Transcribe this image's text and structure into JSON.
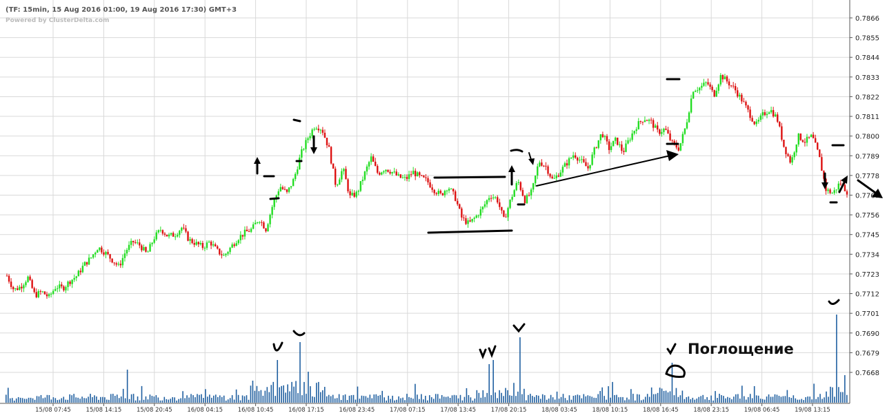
{
  "header": {
    "title": "(TF: 15min, 15 Aug 2016 01:00, 19 Aug 2016 17:30) GMT+3",
    "credit": "Powered by ClusterDelta.com"
  },
  "annotation_label": "Поглощение",
  "colors": {
    "up_candle": "#22dd22",
    "down_candle": "#dd1111",
    "volume": "#1f5fa0",
    "grid": "#d9d9d9",
    "drawing": "#000000"
  },
  "chart_data": {
    "type": "candlestick",
    "symbol_timeframe": "15min",
    "y_ticks": [
      0.7866,
      0.7855,
      0.7844,
      0.7833,
      0.7822,
      0.7811,
      0.78,
      0.7789,
      0.7778,
      0.7767,
      0.7756,
      0.7745,
      0.7734,
      0.7723,
      0.7712,
      0.7701,
      0.769,
      0.7679,
      0.7668
    ],
    "y_tick_labels": [
      "0.7866",
      "0.7855",
      "0.7844",
      "0.7833",
      "0.7822",
      "0.7811",
      "0.7800",
      "0.7789",
      "0.7778",
      "0.7767",
      "0.7756",
      "0.7745",
      "0.7734",
      "0.7723",
      "0.7712",
      "0.7701",
      "0.7690",
      "0.7679",
      "0.7668"
    ],
    "ylim": [
      0.7661,
      0.7871
    ],
    "x_tick_labels": [
      "15/08 07:45",
      "15/08 14:15",
      "15/08 20:45",
      "16/08 04:15",
      "16/08 10:45",
      "16/08 17:15",
      "16/08 23:45",
      "17/08 07:15",
      "17/08 13:45",
      "17/08 20:15",
      "18/08 03:45",
      "18/08 10:15",
      "18/08 16:45",
      "18/08 23:15",
      "19/08 06:45",
      "19/08 13:15"
    ],
    "price_path": [
      [
        0.7722,
        0.7714,
        0.7716,
        0.7721,
        0.7711,
        0.7713,
        0.771,
        0.7716,
        0.7715,
        0.7719,
        0.7722,
        0.7728,
        0.7732,
        0.7738,
        0.7735,
        0.7731,
        0.7727,
        0.7736,
        0.7741,
        0.7739,
        0.7734,
        0.7743,
        0.7748,
        0.7744,
        0.7745,
        0.7749,
        0.7742,
        0.774,
        0.7738,
        0.7741,
        0.7736,
        0.7733,
        0.7738,
        0.7743,
        0.7746,
        0.7748,
        0.7754,
        0.7748,
        0.7762,
        0.7772,
        0.7768,
        0.7776,
        0.779,
        0.7799,
        0.7806,
        0.7804,
        0.7793,
        0.7772,
        0.7782,
        0.7766,
        0.7768,
        0.7778,
        0.7788,
        0.7779,
        0.7782,
        0.778,
        0.7777,
        0.7776,
        0.778,
        0.7777,
        0.7775,
        0.777,
        0.7767,
        0.7772,
        0.7766,
        0.7754,
        0.7751,
        0.7755,
        0.776,
        0.7767,
        0.7765,
        0.7753,
        0.7765,
        0.7775,
        0.7764,
        0.7769,
        0.7786,
        0.7783,
        0.7775,
        0.778,
        0.7785,
        0.779,
        0.7786,
        0.7782,
        0.7793,
        0.7802,
        0.7793,
        0.7798,
        0.7791,
        0.7799,
        0.7806,
        0.781,
        0.7808,
        0.7802,
        0.7804,
        0.7796,
        0.7793,
        0.7806,
        0.7826,
        0.7827,
        0.783,
        0.7823,
        0.7834,
        0.783,
        0.7826,
        0.782,
        0.7813,
        0.7806,
        0.7812,
        0.7815,
        0.781,
        0.7794,
        0.7785,
        0.78,
        0.7797,
        0.78,
        0.7789,
        0.777,
        0.7768,
        0.7774,
        0.7769
      ]
    ],
    "volume_spikes": [
      {
        "x_label": "16/08 10:45",
        "note": "spike"
      },
      {
        "x_label": "16/08 17:15",
        "note": "spike"
      },
      {
        "x_label": "17/08 20:15",
        "note": "spike"
      },
      {
        "x_label": "19/08 13:15",
        "note": "largest spike"
      }
    ],
    "grid": true
  }
}
